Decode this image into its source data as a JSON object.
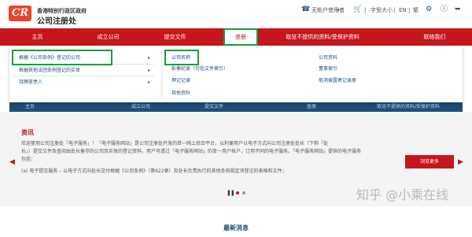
{
  "header": {
    "logo_text": "CR",
    "org_line1": "香港特别行政区政府",
    "org_line2": "公司注册处",
    "user": "无帐户使用者",
    "font_size": "字型大小",
    "lang_en": "EN",
    "lang_tc": "繁"
  },
  "nav": {
    "items": [
      "主页",
      "成立公司",
      "提交文件",
      "查册",
      "取览不提供的资料/受保护资料",
      "联络我们"
    ]
  },
  "dropdown": {
    "col1": [
      "根据《公司条例》登记的公司",
      "根据其他法团条例登记的实体",
      "持牌放债人"
    ],
    "col2": [
      "公司名称",
      "影像纪录（包括文件索引）",
      "押记记录",
      "其他资料"
    ],
    "col3": [
      "公司资料",
      "董事索引",
      "取消披露寄记录册"
    ]
  },
  "tabs": [
    "主页",
    "成立公司",
    "提交文件",
    "查册",
    "取览不提供的资料/受保护资料"
  ],
  "info": {
    "title": "资讯",
    "lines": [
      "欢迎使用公司注册处「电子服务」！「电子服务网站」是公司注册处开发的单一网上综合平台，以利便用户以电子方式向公司注册处处长（下称「处",
      "长」）提交文件及查阅由处长备存的公司及实体的登记资料。用户可透过「电子服务网站」的单一用户帐户，订用不同的电子服务。「电子服务网站」提供的电子服务",
      "包括：",
      "(a) 电子提交服务 – 以电子方式向处长交付根据《公司条例》（第622章）及处长负责执行的其他条例规定须登记的表格和文件；"
    ],
    "more_button": "浏览更多"
  },
  "watermark": "知乎 @小乘在线",
  "news_title": "最新消息"
}
